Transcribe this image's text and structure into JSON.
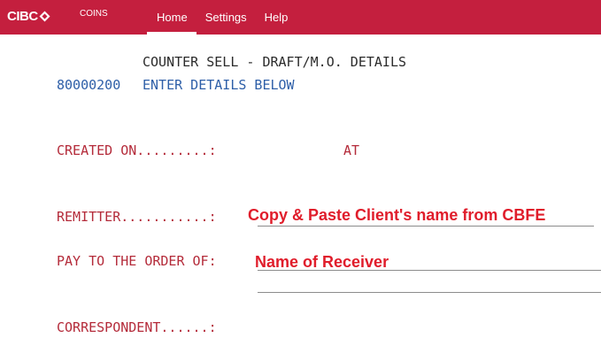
{
  "header": {
    "logo_text": "CIBC",
    "app_name": "COINS",
    "nav": [
      {
        "label": "Home",
        "active": true
      },
      {
        "label": "Settings",
        "active": false
      },
      {
        "label": "Help",
        "active": false
      }
    ],
    "colors": {
      "bar": "#c41f3e",
      "text": "#ffffff"
    }
  },
  "screen": {
    "title": "COUNTER SELL - DRAFT/M.O. DETAILS",
    "message_code": "80000200",
    "message_text": "ENTER DETAILS BELOW",
    "created_on_label": "CREATED ON.........:",
    "at_label": "AT",
    "remitter_label": "REMITTER...........:",
    "remitter_value": "Copy & Paste Client's name from CBFE",
    "pay_to_label": "PAY TO THE ORDER OF:",
    "pay_to_value": "Name of Receiver",
    "correspondent_label": "CORRESPONDENT......:"
  }
}
